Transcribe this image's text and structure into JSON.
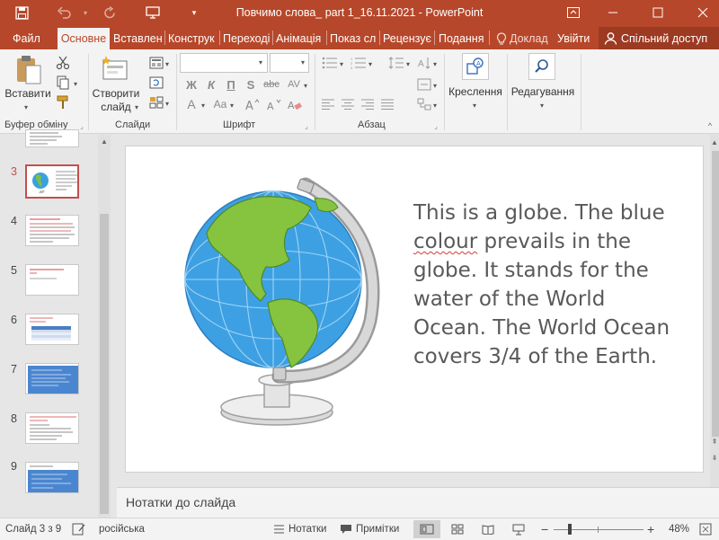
{
  "window": {
    "title": "Повчимо слова_ part 1_16.11.2021 - PowerPoint"
  },
  "tabs": [
    {
      "label": "Файл"
    },
    {
      "label": "Основне"
    },
    {
      "label": "Вставлен"
    },
    {
      "label": "Конструк"
    },
    {
      "label": "Переході"
    },
    {
      "label": "Анімація"
    },
    {
      "label": "Показ сл"
    },
    {
      "label": "Рецензує"
    },
    {
      "label": "Подання"
    },
    {
      "label": "Доклад"
    },
    {
      "label": "Увійти"
    }
  ],
  "share_label": "Спільний доступ",
  "ribbon": {
    "paste_label": "Вставити",
    "new_slide_label": "Створити слайд",
    "drawing_label": "Креслення",
    "editing_label": "Редагування",
    "font_buttons": {
      "bold": "Ж",
      "italic": "К",
      "underline": "П",
      "strike": "S",
      "abc": "abc",
      "av": "AV",
      "a": "A",
      "aa": "Aa"
    },
    "groups": {
      "clipboard": "Буфер обміну",
      "slides": "Слайди",
      "font": "Шрифт",
      "paragraph": "Абзац"
    }
  },
  "thumbnails": [
    {
      "number": "3"
    },
    {
      "number": "4"
    },
    {
      "number": "5"
    },
    {
      "number": "6"
    },
    {
      "number": "7"
    },
    {
      "number": "8"
    },
    {
      "number": "9"
    }
  ],
  "slide": {
    "text_before": "This is a globe. The blue ",
    "text_misspelled": "colour",
    "text_after": " prevails in the globe. It stands for the water of the World Ocean. The World Ocean covers 3/4 of the Earth."
  },
  "notes_placeholder": "Нотатки до слайда",
  "status": {
    "slide_counter": "Слайд 3 з 9",
    "language": "російська",
    "notes_label": "Нотатки",
    "comments_label": "Примітки",
    "zoom": "48%"
  },
  "colors": {
    "accent": "#b7472a",
    "selected_border": "#c0504d"
  }
}
